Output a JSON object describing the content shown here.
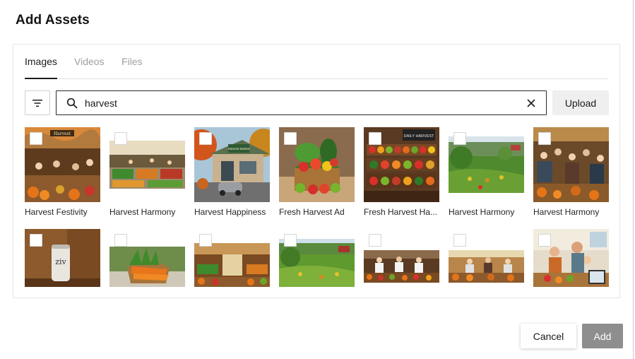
{
  "dialog": {
    "title": "Add Assets"
  },
  "tabs": [
    {
      "label": "Images",
      "active": true
    },
    {
      "label": "Videos",
      "active": false
    },
    {
      "label": "Files",
      "active": false
    }
  ],
  "search": {
    "value": "harvest",
    "placeholder": ""
  },
  "toolbar": {
    "upload_label": "Upload"
  },
  "icons": {
    "filter": "filter-icon",
    "search": "search-icon",
    "clear": "close-icon"
  },
  "assets_row1": [
    {
      "caption": "Harvest Festivity"
    },
    {
      "caption": "Harvest Harmony"
    },
    {
      "caption": "Harvest Happiness"
    },
    {
      "caption": "Fresh Harvest Ad"
    },
    {
      "caption": "Fresh Harvest Ha..."
    },
    {
      "caption": "Harvest Harmony"
    },
    {
      "caption": "Harvest Harmony"
    }
  ],
  "assets_row2_count": 7,
  "thumb_text": {
    "sign_market": "Harvest",
    "sign_store": "Harvest Market",
    "board_daily": "DAILY HARVEST",
    "can_label": "ziv"
  },
  "footer": {
    "cancel_label": "Cancel",
    "add_label": "Add"
  },
  "colors": {
    "add_button_bg": "#8e8e8e",
    "primary_text": "#1a1a1a",
    "muted_tab": "#a0a0a0"
  }
}
